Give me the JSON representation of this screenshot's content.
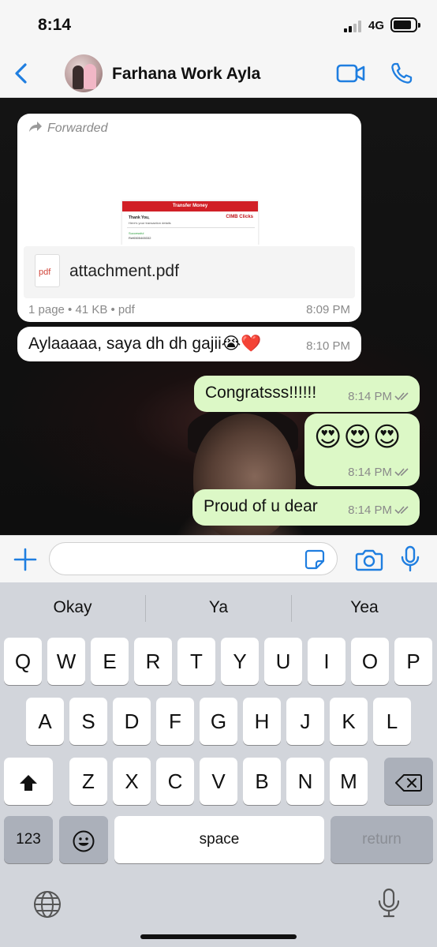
{
  "status": {
    "time": "8:14",
    "network": "4G"
  },
  "header": {
    "back_icon": "chevron-left-icon",
    "contact_name": "Farhana Work Ayla",
    "video_icon": "video-camera-icon",
    "call_icon": "phone-icon",
    "accent": "#1f7ee0"
  },
  "chat": {
    "forwarded": {
      "label": "Forwarded",
      "preview": {
        "band": "Transfer Money",
        "thanks": "Thank You,",
        "subtitle": "Here's your transaction details",
        "logo": "CIMB Clicks",
        "status": "Successful",
        "reference": "Ref6505465332"
      },
      "file_name": "attachment.pdf",
      "file_type_label": "pdf",
      "file_info": "1 page • 41 KB • pdf",
      "time": "8:09 PM"
    },
    "messages": [
      {
        "direction": "in",
        "text": "Aylaaaaa, saya dh dh gajii😭❤️",
        "time": "8:10 PM"
      },
      {
        "direction": "out",
        "text": "Congratsss!!!!!!",
        "time": "8:14 PM"
      },
      {
        "direction": "out",
        "text": "😍😍😍",
        "time": "8:14 PM"
      },
      {
        "direction": "out",
        "text": "Proud of u dear",
        "time": "8:14 PM"
      }
    ]
  },
  "composer": {
    "value": "",
    "placeholder": ""
  },
  "keyboard": {
    "suggestions": [
      "Okay",
      "Ya",
      "Yea"
    ],
    "row1": [
      "Q",
      "W",
      "E",
      "R",
      "T",
      "Y",
      "U",
      "I",
      "O",
      "P"
    ],
    "row2": [
      "A",
      "S",
      "D",
      "F",
      "G",
      "H",
      "J",
      "K",
      "L"
    ],
    "row3": [
      "Z",
      "X",
      "C",
      "V",
      "B",
      "N",
      "M"
    ],
    "numbers": "123",
    "space": "space",
    "return": "return"
  }
}
